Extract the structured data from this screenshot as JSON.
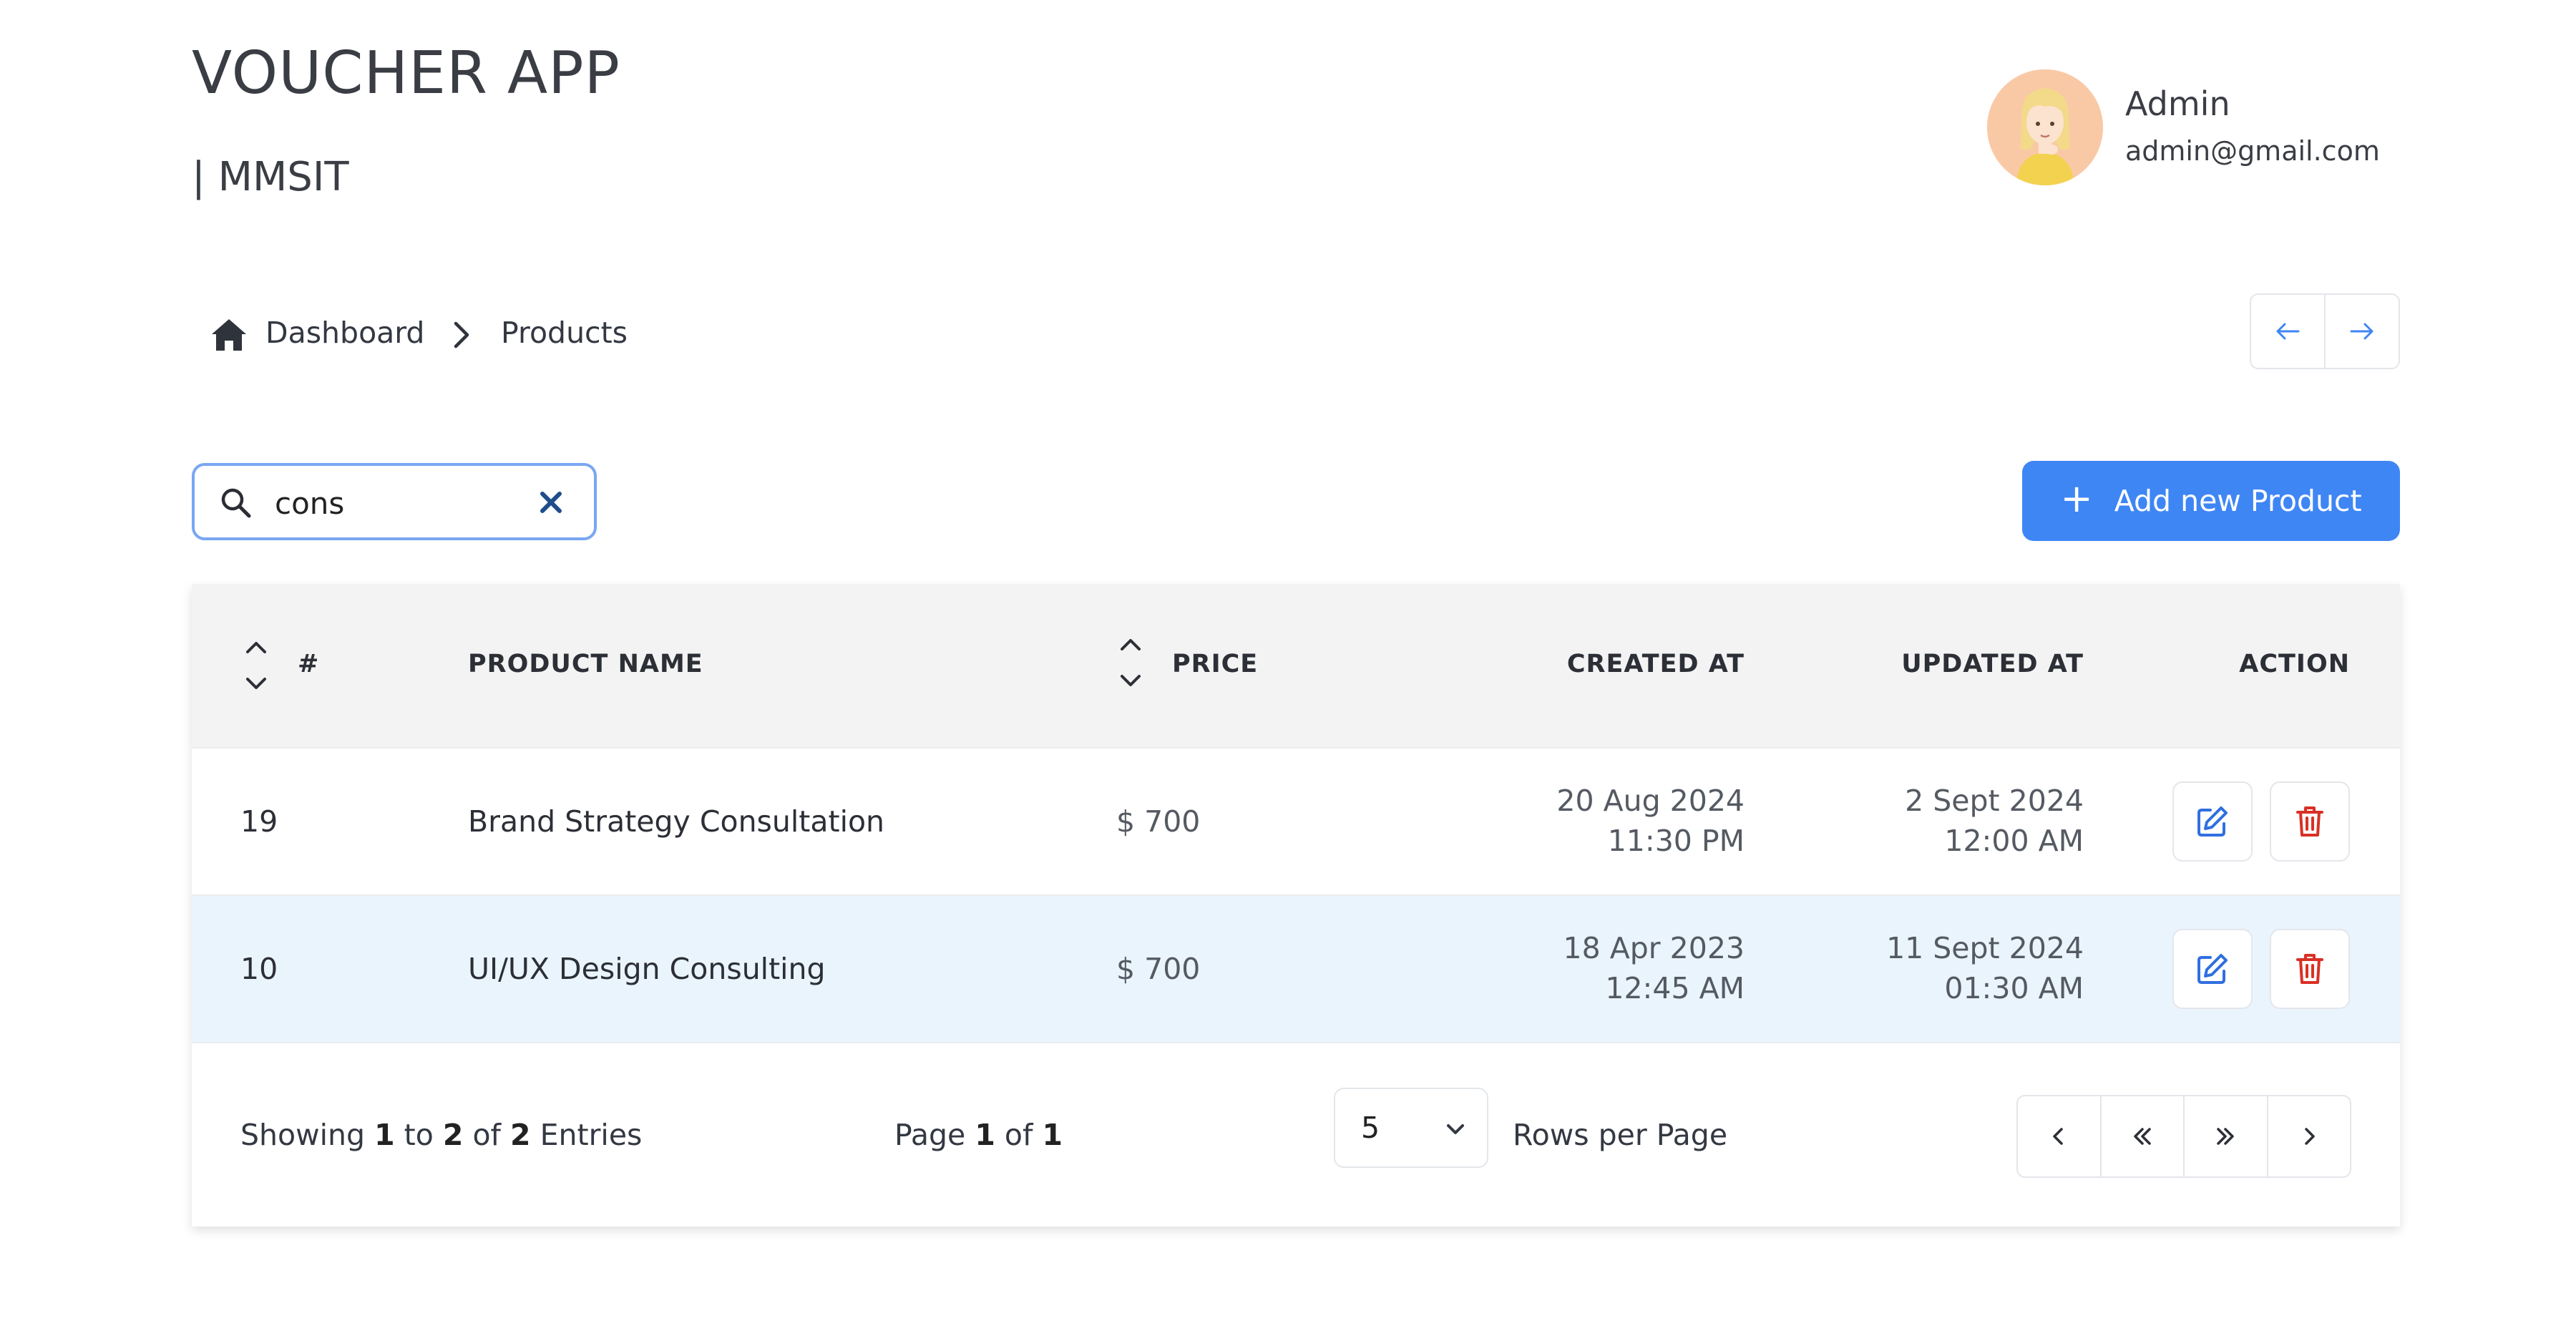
{
  "header": {
    "title": "VOUCHER APP",
    "subtitle": "| MMSIT",
    "user": {
      "name": "Admin",
      "email": "admin@gmail.com"
    }
  },
  "breadcrumb": {
    "home": "Dashboard",
    "current": "Products"
  },
  "search": {
    "value": "cons",
    "placeholder": ""
  },
  "actions": {
    "add_label": "Add new Product",
    "add_icon": "plus-icon"
  },
  "table": {
    "columns": [
      "#",
      "PRODUCT NAME",
      "PRICE",
      "CREATED AT",
      "UPDATED AT",
      "ACTION"
    ],
    "rows": [
      {
        "id": "19",
        "name": "Brand Strategy Consultation",
        "price": "$ 700",
        "created_date": "20 Aug 2024",
        "created_time": "11:30 PM",
        "updated_date": "2 Sept 2024",
        "updated_time": "12:00 AM"
      },
      {
        "id": "10",
        "name": "UI/UX Design Consulting",
        "price": "$ 700",
        "created_date": "18 Apr 2023",
        "created_time": "12:45 AM",
        "updated_date": "11 Sept 2024",
        "updated_time": "01:30 AM"
      }
    ]
  },
  "footer": {
    "showing_prefix": "Showing",
    "from": "1",
    "to_word": "to",
    "to": "2",
    "of_word": "of",
    "total": "2",
    "entries_word": "Entries",
    "page_word": "Page",
    "page": "1",
    "page_of_word": "of",
    "pages": "1",
    "rows_per_page_value": "5",
    "rows_per_page_label": "Rows per Page"
  },
  "colors": {
    "accent": "#3f86f5",
    "edit": "#2f6fe0",
    "delete": "#d93025",
    "highlight_row": "#eaf4fd",
    "header_bg": "#f3f3f3"
  }
}
